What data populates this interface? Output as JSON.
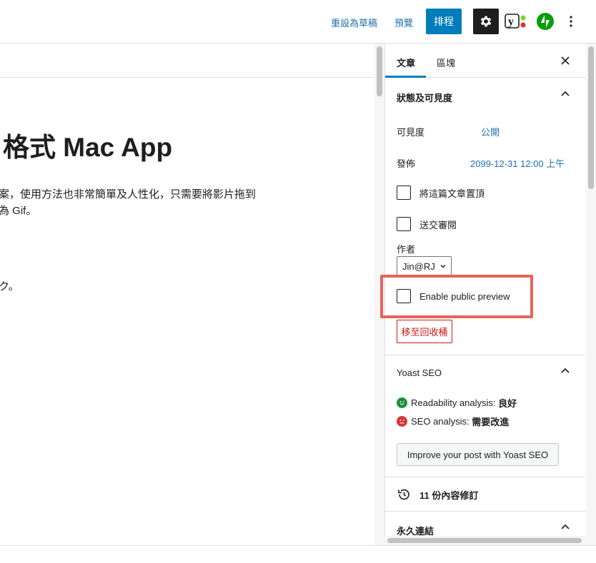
{
  "header": {
    "revert_draft_label": "重設為草稿",
    "preview_label": "預覽",
    "schedule_label": "排程",
    "settings_icon": "gear-icon",
    "yoast_icon": "yoast-icon",
    "jetpack_icon": "jetpack-icon",
    "more_icon": "more-vertical-icon"
  },
  "editor": {
    "title": "格式 Mac App",
    "paragraphs": [
      "案，使用方法也非常簡單及人性化，只需要將影片拖到",
      "為 Gif。",
      "ク。"
    ]
  },
  "sidebar": {
    "tabs": [
      "文章",
      "區塊"
    ],
    "status_panel": {
      "title": "狀態及可見度",
      "visibility_label": "可見度",
      "visibility_value": "公開",
      "publish_label": "發佈",
      "publish_value": "2099-12-31 12:00 上午",
      "sticky_label": "將這篇文章置頂",
      "pending_label": "送交審閱",
      "author_label": "作者",
      "author_value": "Jin@RJ",
      "public_preview_label": "Enable public preview",
      "trash_label": "移至回收桶"
    },
    "yoast_panel": {
      "title": "Yoast SEO",
      "readability_label": "Readability analysis:",
      "readability_value": "良好",
      "seo_label": "SEO analysis:",
      "seo_value": "需要改進",
      "improve_button": "Improve your post with Yoast SEO"
    },
    "revisions_label": "11 份內容修訂",
    "permalink_title": "永久連結"
  },
  "colors": {
    "accent": "#007cba",
    "link": "#2271b1",
    "highlight": "#e8645a",
    "danger": "#cc1818",
    "good": "#1e8e3e",
    "bad": "#d63638"
  }
}
